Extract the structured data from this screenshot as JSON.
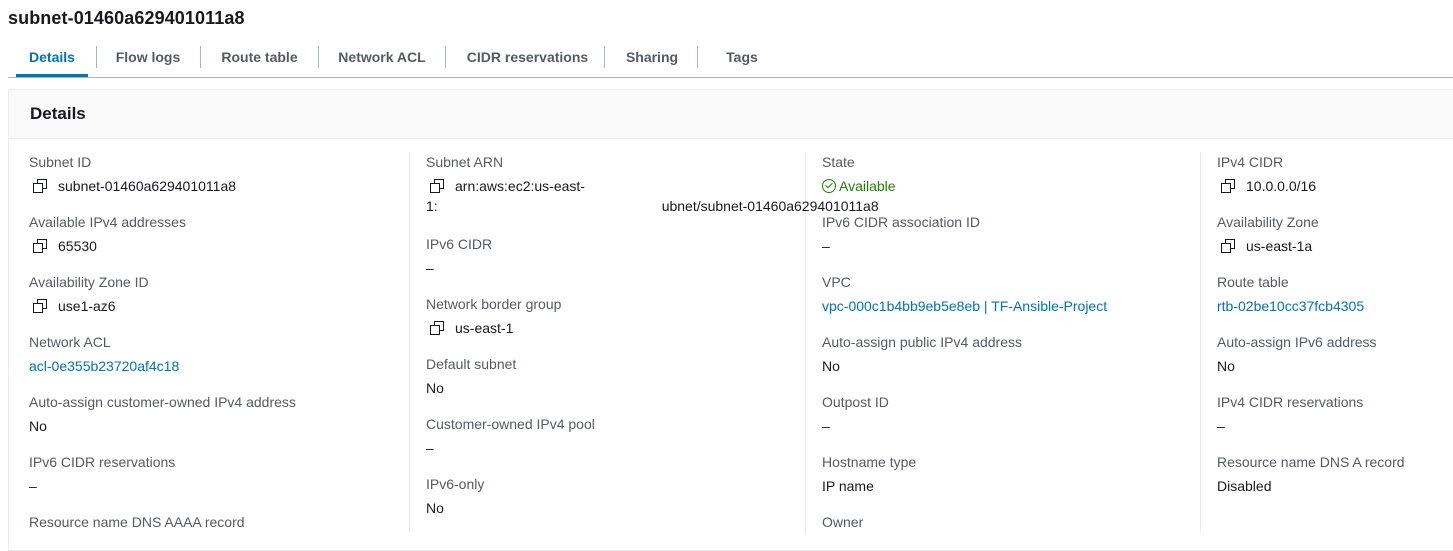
{
  "page": {
    "title": "subnet-01460a629401011a8"
  },
  "tabs": [
    {
      "label": "Details",
      "active": true
    },
    {
      "label": "Flow logs",
      "active": false
    },
    {
      "label": "Route table",
      "active": false
    },
    {
      "label": "Network ACL",
      "active": false
    },
    {
      "label": "CIDR reservations",
      "active": false
    },
    {
      "label": "Sharing",
      "active": false
    },
    {
      "label": "Tags",
      "active": false
    }
  ],
  "panel": {
    "title": "Details"
  },
  "columns": {
    "col1": {
      "subnet_id": {
        "label": "Subnet ID",
        "value": "subnet-01460a629401011a8"
      },
      "available_ipv4": {
        "label": "Available IPv4 addresses",
        "value": "65530"
      },
      "az_id": {
        "label": "Availability Zone ID",
        "value": "use1-az6"
      },
      "network_acl": {
        "label": "Network ACL",
        "value": "acl-0e355b23720af4c18"
      },
      "auto_assign_customer_ipv4": {
        "label": "Auto-assign customer-owned IPv4 address",
        "value": "No"
      },
      "ipv6_cidr_reservations": {
        "label": "IPv6 CIDR reservations",
        "value": "–"
      },
      "dns_aaaa": {
        "label": "Resource name DNS AAAA record"
      }
    },
    "col2": {
      "subnet_arn": {
        "label": "Subnet ARN",
        "value_line1": "arn:aws:ec2:us-east-",
        "value_line2_start": "1:",
        "value_line2_end": "ubnet/subnet-01460a629401011a8"
      },
      "ipv6_cidr": {
        "label": "IPv6 CIDR",
        "value": "–"
      },
      "network_border_group": {
        "label": "Network border group",
        "value": "us-east-1"
      },
      "default_subnet": {
        "label": "Default subnet",
        "value": "No"
      },
      "customer_ipv4_pool": {
        "label": "Customer-owned IPv4 pool",
        "value": "–"
      },
      "ipv6_only": {
        "label": "IPv6-only",
        "value": "No"
      }
    },
    "col3": {
      "state": {
        "label": "State",
        "value": "Available"
      },
      "ipv6_assoc_id": {
        "label": "IPv6 CIDR association ID",
        "value": "–"
      },
      "vpc": {
        "label": "VPC",
        "value": "vpc-000c1b4bb9eb5e8eb | TF-Ansible-Project"
      },
      "auto_assign_public_ipv4": {
        "label": "Auto-assign public IPv4 address",
        "value": "No"
      },
      "outpost_id": {
        "label": "Outpost ID",
        "value": "–"
      },
      "hostname_type": {
        "label": "Hostname type",
        "value": "IP name"
      },
      "owner": {
        "label": "Owner"
      }
    },
    "col4": {
      "ipv4_cidr": {
        "label": "IPv4 CIDR",
        "value": "10.0.0.0/16"
      },
      "az": {
        "label": "Availability Zone",
        "value": "us-east-1a"
      },
      "route_table": {
        "label": "Route table",
        "value": "rtb-02be10cc37fcb4305"
      },
      "auto_assign_ipv6": {
        "label": "Auto-assign IPv6 address",
        "value": "No"
      },
      "ipv4_cidr_reservations": {
        "label": "IPv4 CIDR reservations",
        "value": "–"
      },
      "dns_a": {
        "label": "Resource name DNS A record",
        "value": "Disabled"
      }
    }
  },
  "colors": {
    "link": "#0073bb",
    "success": "#1d8102",
    "label": "#545b64",
    "text": "#16191f"
  },
  "icons": {
    "copy": "copy-icon",
    "status": "check-circle-icon"
  }
}
